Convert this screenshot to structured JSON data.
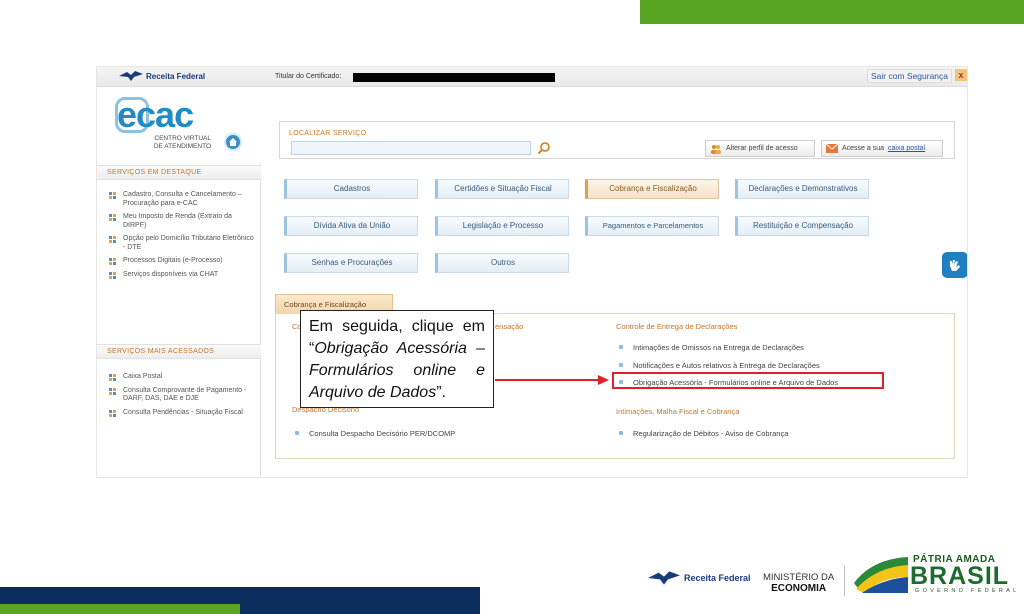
{
  "header": {
    "brand": "Receita Federal",
    "titular_label": "Titular do Certificado:",
    "logout_label": "Sair com Segurança",
    "close_label": "x"
  },
  "ecac": {
    "logo_text": "ecac",
    "subtitle_line1": "CENTRO VIRTUAL",
    "subtitle_line2": "DE ATENDIMENTO"
  },
  "search": {
    "label": "LOCALIZAR SERVIÇO",
    "value": "",
    "change_profile": "Alterar perfil de acesso",
    "mailbox_prefix": "Acesse a sua ",
    "mailbox_link": "caixa postal"
  },
  "sidebar": {
    "featured_title": "SERVIÇOS EM DESTAQUE",
    "featured_items": [
      "Cadastro, Consulta e Cancelamento – Procuração para e-CAC",
      "Meu Imposto de Renda (Extrato da DIRPF)",
      "Opção pelo Domicílio Tributário Eletrônico - DTE",
      "Processos Digitais (e-Processo)",
      "Serviços disponíveis via CHAT"
    ],
    "most_accessed_title": "SERVIÇOS MAIS ACESSADOS",
    "most_accessed_items": [
      "Caixa Postal",
      "Consulta Comprovante de Pagamento - DARF, DAS, DAE e DJE",
      "Consulta Pendências - Situação Fiscal"
    ]
  },
  "tiles": [
    "Cadastros",
    "Certidões e Situação Fiscal",
    "Cobrança e Fiscalização",
    "Declarações e Demonstrativos",
    "Dívida Ativa da União",
    "Legislação e Processo",
    "Pagamentos e Parcelamentos",
    "Restituição e Compensação",
    "Senhas e Procurações",
    "Outros"
  ],
  "panel": {
    "tab_label": "Cobrança e Fiscalização",
    "left_section_fragment": "Co",
    "left_section_tail": "ensação",
    "left_item_fragment": "",
    "despacho_title": "Despacho Decisório",
    "despacho_item": "Consulta Despacho Decisório PER/DCOMP",
    "right_section_title": "Controle de Entrega de Declarações",
    "right_items": [
      "Intimações de Omissos na Entrega de Declarações",
      "Notificações e Autos relativos à Entrega de Declarações",
      "Obrigação Acessória - Formulários online e Arquivo de Dados"
    ],
    "right_section2_title": "Intimações, Malha Fiscal e Cobrança",
    "right_section2_item": "Regularização de Débitos - Aviso de Cobrança"
  },
  "callout": {
    "prefix": "Em seguida, clique em “",
    "italic": "Obrigação Acessória – Formulários online e Arquivo de Dados",
    "suffix": "”."
  },
  "footer": {
    "rf_brand": "Receita Federal",
    "ministry_line1": "MINISTÉRIO DA",
    "ministry_line2": "ECONOMIA",
    "patria": "PÁTRIA AMADA",
    "brasil": "BRASIL",
    "governo": "GOVERNO FEDERAL"
  },
  "colors": {
    "accent_green": "#5aa423",
    "navy": "#0e2d5f",
    "highlight_red": "#e3202a",
    "section_orange": "#c2772d"
  }
}
